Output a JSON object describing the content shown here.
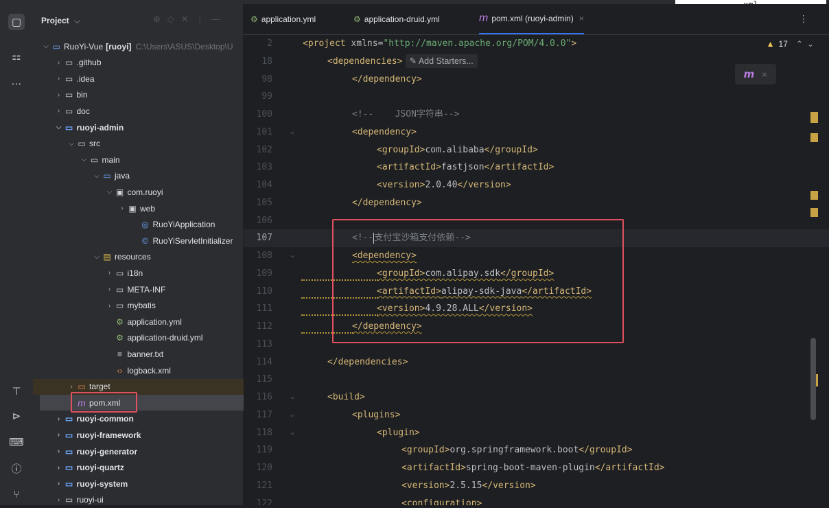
{
  "top_float_text": "xml",
  "activity_bar": {
    "top": [
      {
        "name": "folder-icon",
        "glyph": "▢"
      },
      {
        "name": "structure-icon",
        "glyph": "⚏"
      },
      {
        "name": "more-icon",
        "glyph": "⋯"
      }
    ],
    "bottom": [
      {
        "name": "build-hammer-icon",
        "glyph": "⊤"
      },
      {
        "name": "run-icon",
        "glyph": "⊳"
      },
      {
        "name": "terminal-icon",
        "glyph": "⌨"
      },
      {
        "name": "problems-icon",
        "glyph": "ⓘ"
      },
      {
        "name": "git-icon",
        "glyph": "⑂"
      }
    ]
  },
  "project_panel": {
    "title": "Project",
    "title_chevron": "⌵",
    "tools": [
      "⊕",
      "◇",
      "✕",
      "⋮",
      "—"
    ],
    "tree": [
      {
        "depth": 0,
        "chev": "⌵",
        "icon": "module",
        "label": "RuoYi-Vue",
        "bold_suffix": "[ruoyi]",
        "path": "C:\\Users\\ASUS\\Desktop\\U"
      },
      {
        "depth": 1,
        "chev": "›",
        "icon": "folder",
        "label": ".github"
      },
      {
        "depth": 1,
        "chev": "›",
        "icon": "folder",
        "label": ".idea"
      },
      {
        "depth": 1,
        "chev": "›",
        "icon": "folder",
        "label": "bin"
      },
      {
        "depth": 1,
        "chev": "›",
        "icon": "folder",
        "label": "doc"
      },
      {
        "depth": 1,
        "chev": "⌵",
        "icon": "module",
        "label": "ruoyi-admin",
        "bold": true
      },
      {
        "depth": 2,
        "chev": "⌵",
        "icon": "folder",
        "label": "src"
      },
      {
        "depth": 3,
        "chev": "⌵",
        "icon": "folder",
        "label": "main"
      },
      {
        "depth": 4,
        "chev": "⌵",
        "icon": "folder-src",
        "label": "java"
      },
      {
        "depth": 5,
        "chev": "⌵",
        "icon": "package",
        "label": "com.ruoyi"
      },
      {
        "depth": 6,
        "chev": "›",
        "icon": "package",
        "label": "web"
      },
      {
        "depth": 7,
        "chev": "",
        "icon": "spring-class",
        "label": "RuoYiApplication"
      },
      {
        "depth": 7,
        "chev": "",
        "icon": "class",
        "label": "RuoYiServletInitializer"
      },
      {
        "depth": 4,
        "chev": "⌵",
        "icon": "folder-res",
        "label": "resources"
      },
      {
        "depth": 5,
        "chev": "›",
        "icon": "folder",
        "label": "i18n"
      },
      {
        "depth": 5,
        "chev": "›",
        "icon": "folder",
        "label": "META-INF"
      },
      {
        "depth": 5,
        "chev": "›",
        "icon": "folder",
        "label": "mybatis"
      },
      {
        "depth": 5,
        "chev": "",
        "icon": "yml",
        "label": "application.yml"
      },
      {
        "depth": 5,
        "chev": "",
        "icon": "yml",
        "label": "application-druid.yml"
      },
      {
        "depth": 5,
        "chev": "",
        "icon": "txt",
        "label": "banner.txt"
      },
      {
        "depth": 5,
        "chev": "",
        "icon": "xml",
        "label": "logback.xml"
      },
      {
        "depth": 2,
        "chev": "›",
        "icon": "folder-excluded",
        "label": "target",
        "state": "target"
      },
      {
        "depth": 2,
        "chev": "",
        "icon": "maven",
        "label": "pom.xml",
        "state": "selected"
      },
      {
        "depth": 1,
        "chev": "›",
        "icon": "module",
        "label": "ruoyi-common",
        "bold": true
      },
      {
        "depth": 1,
        "chev": "›",
        "icon": "module",
        "label": "ruoyi-framework",
        "bold": true
      },
      {
        "depth": 1,
        "chev": "›",
        "icon": "module",
        "label": "ruoyi-generator",
        "bold": true
      },
      {
        "depth": 1,
        "chev": "›",
        "icon": "module",
        "label": "ruoyi-quartz",
        "bold": true
      },
      {
        "depth": 1,
        "chev": "›",
        "icon": "module",
        "label": "ruoyi-system",
        "bold": true
      },
      {
        "depth": 1,
        "chev": "›",
        "icon": "folder",
        "label": "ruoyi-ui"
      }
    ]
  },
  "tabs": [
    {
      "icon": "yml",
      "label": "application.yml",
      "active": false
    },
    {
      "icon": "yml",
      "label": "application-druid.yml",
      "active": false
    },
    {
      "icon": "maven",
      "label": "pom.xml (ruoyi-admin)",
      "active": true,
      "close": "×"
    }
  ],
  "tabs_more": "⋮",
  "editor": {
    "warning_count": "17",
    "warning_icon": "▲",
    "nav_up": "⌃",
    "nav_down": "⌄",
    "maven_reload_label": "m",
    "maven_close": "×",
    "add_starters": "Add Starters...",
    "lines": [
      {
        "num": "2",
        "segs": [
          [
            "t",
            "<project "
          ],
          [
            "attr",
            "xmlns"
          ],
          [
            "txt",
            "="
          ],
          [
            "val",
            "\"http://maven.apache.org/POM/4.0.0\""
          ],
          [
            "t",
            ">"
          ]
        ]
      },
      {
        "num": "18",
        "indent": 1,
        "starters": true,
        "segs": [
          [
            "t",
            "<dependencies>"
          ]
        ]
      },
      {
        "num": "98",
        "indent": 2,
        "segs": [
          [
            "t",
            "</dependency>"
          ]
        ]
      },
      {
        "num": "99",
        "segs": []
      },
      {
        "num": "100",
        "indent": 2,
        "segs": [
          [
            "cmt",
            "<!--    JSON字符串-->"
          ]
        ]
      },
      {
        "num": "101",
        "indent": 2,
        "fold": true,
        "segs": [
          [
            "t",
            "<dependency>"
          ]
        ]
      },
      {
        "num": "102",
        "indent": 3,
        "segs": [
          [
            "t",
            "<groupId>"
          ],
          [
            "txt",
            "com.alibaba"
          ],
          [
            "t",
            "</groupId>"
          ]
        ]
      },
      {
        "num": "103",
        "indent": 3,
        "segs": [
          [
            "t",
            "<artifactId>"
          ],
          [
            "txt",
            "fastjson"
          ],
          [
            "t",
            "</artifactId>"
          ]
        ]
      },
      {
        "num": "104",
        "indent": 3,
        "segs": [
          [
            "t",
            "<version>"
          ],
          [
            "txt",
            "2.0.40"
          ],
          [
            "t",
            "</version>"
          ]
        ]
      },
      {
        "num": "105",
        "indent": 2,
        "segs": [
          [
            "t",
            "</dependency>"
          ]
        ]
      },
      {
        "num": "106",
        "segs": []
      },
      {
        "num": "107",
        "indent": 2,
        "current": true,
        "caret": true,
        "segs": [
          [
            "cmt",
            "<!--"
          ],
          [
            "caret",
            ""
          ],
          [
            "cmt",
            "支付宝沙箱支付依赖-->"
          ]
        ]
      },
      {
        "num": "108",
        "indent": 2,
        "fold": true,
        "wavy": true,
        "segs": [
          [
            "t",
            "<dependency>"
          ]
        ]
      },
      {
        "num": "109",
        "indent": 3,
        "wavy": true,
        "segs": [
          [
            "t",
            "<groupId>"
          ],
          [
            "txt",
            "com.alipay.sdk"
          ],
          [
            "t",
            "</groupId>"
          ]
        ]
      },
      {
        "num": "110",
        "indent": 3,
        "wavy": true,
        "segs": [
          [
            "t",
            "<artifactId>"
          ],
          [
            "txt",
            "alipay-sdk-java"
          ],
          [
            "t",
            "</artifactId>"
          ]
        ]
      },
      {
        "num": "111",
        "indent": 3,
        "wavy": true,
        "segs": [
          [
            "t",
            "<version>"
          ],
          [
            "txt",
            "4.9.28.ALL"
          ],
          [
            "t",
            "</version>"
          ]
        ]
      },
      {
        "num": "112",
        "indent": 2,
        "wavy": true,
        "segs": [
          [
            "t",
            "</dependency>"
          ]
        ]
      },
      {
        "num": "113",
        "segs": []
      },
      {
        "num": "114",
        "indent": 1,
        "segs": [
          [
            "t",
            "</dependencies>"
          ]
        ]
      },
      {
        "num": "115",
        "segs": []
      },
      {
        "num": "116",
        "indent": 1,
        "fold": true,
        "segs": [
          [
            "t",
            "<build>"
          ]
        ]
      },
      {
        "num": "117",
        "indent": 2,
        "fold": true,
        "segs": [
          [
            "t",
            "<plugins>"
          ]
        ]
      },
      {
        "num": "118",
        "indent": 3,
        "fold": true,
        "segs": [
          [
            "t",
            "<plugin>"
          ]
        ]
      },
      {
        "num": "119",
        "indent": 4,
        "segs": [
          [
            "t",
            "<groupId>"
          ],
          [
            "txt",
            "org.springframework.boot"
          ],
          [
            "t",
            "</groupId>"
          ]
        ]
      },
      {
        "num": "120",
        "indent": 4,
        "segs": [
          [
            "t",
            "<artifactId>"
          ],
          [
            "txt",
            "spring-boot-maven-plugin"
          ],
          [
            "t",
            "</artifactId>"
          ]
        ]
      },
      {
        "num": "121",
        "indent": 4,
        "segs": [
          [
            "t",
            "<version>"
          ],
          [
            "txt",
            "2.5.15"
          ],
          [
            "t",
            "</version>"
          ]
        ]
      },
      {
        "num": "122",
        "indent": 4,
        "segs": [
          [
            "t",
            "<configuration>"
          ]
        ]
      }
    ]
  },
  "colors": {
    "highlight_box": "#e0505e",
    "accent": "#3574f0",
    "xml_tag": "#d5b778",
    "xml_value": "#6aab73",
    "comment": "#7a7e85"
  }
}
